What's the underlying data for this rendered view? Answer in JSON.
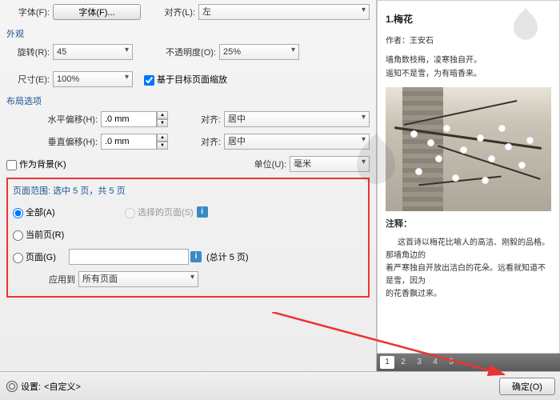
{
  "font": {
    "label": "字体(F):",
    "button": "字体(F)..."
  },
  "align_top": {
    "label": "对齐(L):",
    "value": "左"
  },
  "sections": {
    "appearance": "外观",
    "layout": "布局选项"
  },
  "rotate": {
    "label": "旋转(R):",
    "value": "45"
  },
  "opacity": {
    "label": "不透明度(O):",
    "value": "25%"
  },
  "size": {
    "label": "尺寸(E):",
    "value": "100%"
  },
  "scale_cb": "基于目标页面缩放",
  "hoffset": {
    "label": "水平偏移(H):",
    "value": ".0 mm"
  },
  "voffset": {
    "label": "垂直偏移(H):",
    "value": ".0 mm"
  },
  "halign": {
    "label": "对齐:",
    "value": "居中"
  },
  "valign": {
    "label": "对齐:",
    "value": "居中"
  },
  "as_bg": "作为背景(K)",
  "unit": {
    "label": "单位(U):",
    "value": "毫米"
  },
  "range": {
    "title": "页面范围: 选中 5 页，共 5 页",
    "all": "全部(A)",
    "selected": "选择的页面(S)",
    "current": "当前页(R)",
    "pages": "页面(G)",
    "total": "(总计 5 页)",
    "apply": "应用到",
    "apply_val": "所有页面"
  },
  "footer": {
    "settings": "设置:",
    "preset": "<自定义>",
    "ok": "确定(O)"
  },
  "preview": {
    "title": "1.梅花",
    "author": "作者：王安石",
    "line1": "墙角数枝梅，凌寒独自开。",
    "line2": "遥知不是雪，为有暗香来。",
    "notes_h": "注释：",
    "notes1": "这首诗以梅花比喻人的高洁、刚毅的品格。那墙角边的",
    "notes2": "着严寒独自开放出洁白的花朵。远看就知道不是雪，因为",
    "notes3": "的花香飘过来。"
  },
  "pages": [
    "1",
    "2",
    "3",
    "4",
    "5"
  ]
}
